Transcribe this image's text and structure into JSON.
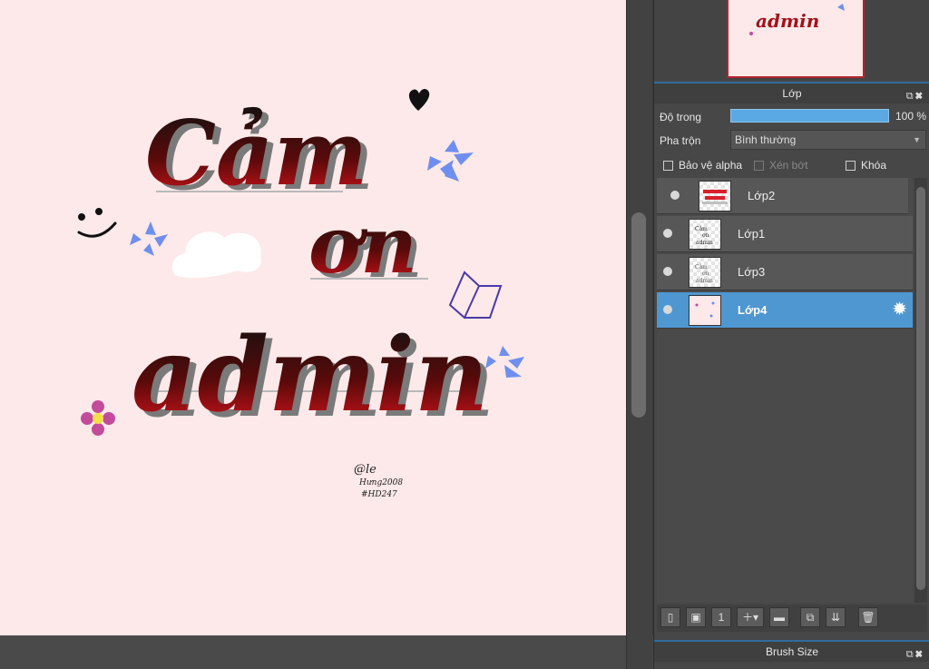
{
  "canvas": {
    "background": "#fde9e9",
    "artwork_text": {
      "line1": "Cảm",
      "line2": "ơn",
      "line3": "admin"
    },
    "signature": [
      "@le",
      "Hưng2008",
      "#HD247"
    ]
  },
  "layer_panel": {
    "title": "Lớp",
    "opacity_label": "Độ trong",
    "opacity_value": "100 %",
    "opacity_fraction": 1.0,
    "blend_label": "Pha trộn",
    "blend_value": "Bình thường",
    "protect_alpha_label": "Bảo vệ alpha",
    "clipping_label": "Xén bớt",
    "lock_label": "Khóa",
    "layers": [
      {
        "name": "Lớp2",
        "selected": false
      },
      {
        "name": "Lớp1",
        "selected": false
      },
      {
        "name": "Lớp3",
        "selected": false
      },
      {
        "name": "Lớp4",
        "selected": true
      }
    ]
  },
  "brush_panel": {
    "title": "Brush Size"
  },
  "colors": {
    "accent": "#4f97d1",
    "panel_bg": "#474747",
    "preview_border": "#b5232b"
  },
  "icons": [
    "popout-icon",
    "close-icon",
    "gear-icon",
    "eye-icon",
    "new-layer-icon",
    "new-folder-icon",
    "trash-icon",
    "caret-down-icon"
  ]
}
